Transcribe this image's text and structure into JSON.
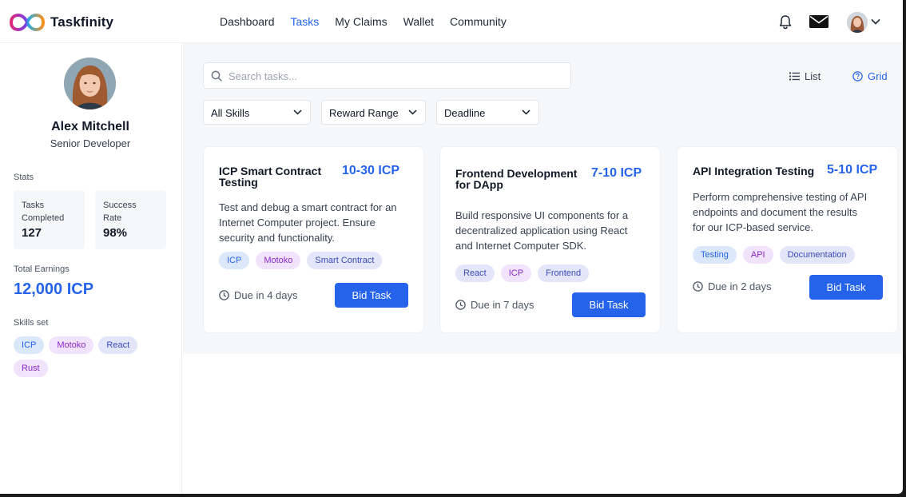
{
  "app": {
    "name": "Taskfinity",
    "accent": "#2563eb"
  },
  "nav": {
    "items": [
      {
        "label": "Dashboard",
        "active": false
      },
      {
        "label": "Tasks",
        "active": true
      },
      {
        "label": "My Claims",
        "active": false
      },
      {
        "label": "Wallet",
        "active": false
      },
      {
        "label": "Community",
        "active": false
      }
    ],
    "icons": [
      "bell-icon",
      "mail-icon",
      "avatar",
      "chevron-down-icon"
    ]
  },
  "profile": {
    "name": "Alex Mitchell",
    "role": "Senior Developer",
    "stats_label": "Stats",
    "stats": [
      {
        "label_line1": "Tasks",
        "label_line2": "Completed",
        "value": "127"
      },
      {
        "label_line1": "Success",
        "label_line2": "Rate",
        "value": "98%"
      }
    ],
    "earnings_label": "Total Earnings",
    "earnings_value": "12,000 ICP",
    "skills_label": "Skills set",
    "skills": [
      {
        "label": "ICP",
        "color": "blue"
      },
      {
        "label": "Motoko",
        "color": "purple"
      },
      {
        "label": "React",
        "color": "indigo"
      },
      {
        "label": "Rust",
        "color": "purple"
      }
    ]
  },
  "toolbar": {
    "search_placeholder": "Search tasks...",
    "view_list": "List",
    "view_grid": "Grid",
    "filters": [
      "All Skills",
      "Reward Range",
      "Deadline"
    ]
  },
  "tasks": [
    {
      "title_line1": "ICP Smart Contract",
      "title_line2": "Testing",
      "reward": "10-30 ICP",
      "desc_lines": [
        "Test and debug a smart contract for an",
        "Internet Computer project. Ensure",
        "security and functionality."
      ],
      "tags": [
        {
          "label": "ICP",
          "color": "blue"
        },
        {
          "label": "Motoko",
          "color": "purple"
        },
        {
          "label": "Smart Contract",
          "color": "indigo"
        }
      ],
      "due": "Due in 4 days",
      "button": "Bid Task"
    },
    {
      "title_line1": "Frontend Development",
      "title_line2": "for DApp",
      "reward": "7-10 ICP",
      "desc_lines": [
        "Build responsive UI components for a",
        "decentralized application using React",
        "and Internet Computer SDK."
      ],
      "tags": [
        {
          "label": "React",
          "color": "indigo"
        },
        {
          "label": "ICP",
          "color": "purple"
        },
        {
          "label": "Frontend",
          "color": "indigo"
        }
      ],
      "due": "Due in 7 days",
      "button": "Bid Task"
    },
    {
      "title_line1": "API Integration Testing",
      "title_line2": "",
      "reward": "5-10 ICP",
      "desc_lines": [
        "Perform comprehensive testing of API",
        "endpoints and document the results",
        "for our ICP-based service."
      ],
      "tags": [
        {
          "label": "Testing",
          "color": "blue"
        },
        {
          "label": "API",
          "color": "purple"
        },
        {
          "label": "Documentation",
          "color": "indigo"
        }
      ],
      "due": "Due in 2 days",
      "button": "Bid Task"
    }
  ]
}
